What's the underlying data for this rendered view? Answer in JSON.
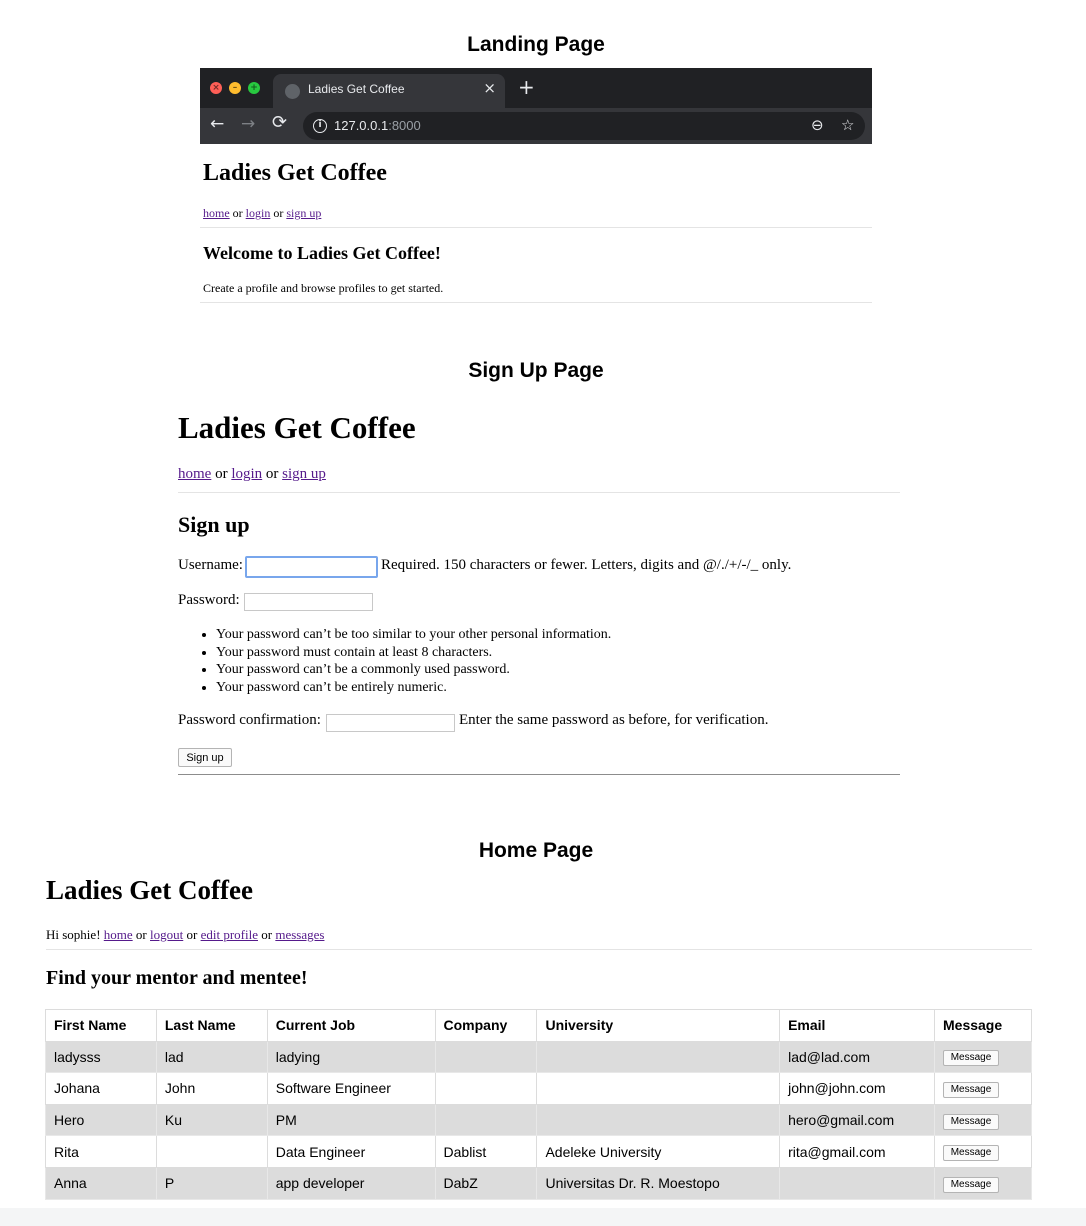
{
  "sections": {
    "landing_title": "Landing Page",
    "signup_title": "Sign Up Page",
    "home_title": "Home Page"
  },
  "browser": {
    "tab_title": "Ladies Get Coffee",
    "tab_close": "×",
    "new_tab": "+",
    "url_host": "127.0.0.1",
    "url_port": ":8000"
  },
  "landing": {
    "site_title": "Ladies Get Coffee",
    "nav": {
      "home": "home",
      "sep1": " or ",
      "login": "login",
      "sep2": " or ",
      "signup": "sign up"
    },
    "heading": "Welcome to Ladies Get Coffee!",
    "text": "Create a profile and browse profiles to get started."
  },
  "signup": {
    "site_title": "Ladies Get Coffee",
    "nav": {
      "home": "home",
      "sep1": " or ",
      "login": "login",
      "sep2": " or ",
      "signup": "sign up"
    },
    "heading": "Sign up",
    "username_label": "Username:",
    "username_help": "Required. 150 characters or fewer. Letters, digits and @/./+/-/_ only.",
    "username_value": "",
    "password_label": "Password:",
    "password_value": "",
    "password_rules": [
      "Your password can’t be too similar to your other personal information.",
      "Your password must contain at least 8 characters.",
      "Your password can’t be a commonly used password.",
      "Your password can’t be entirely numeric."
    ],
    "confirm_label": "Password confirmation:",
    "confirm_value": "",
    "confirm_help": "Enter the same password as before, for verification.",
    "submit_label": "Sign up"
  },
  "home": {
    "site_title": "Ladies Get Coffee",
    "greeting": "Hi sophie! ",
    "nav": {
      "home": "home",
      "sep1": " or ",
      "logout": "logout",
      "sep2": " or ",
      "edit_profile": "edit profile",
      "sep3": " or ",
      "messages": "messages"
    },
    "heading": "Find your mentor and mentee!",
    "columns": [
      "First Name",
      "Last Name",
      "Current Job",
      "Company",
      "University",
      "Email",
      "Message"
    ],
    "rows": [
      [
        "ladysss",
        "lad",
        "ladying",
        "",
        "",
        "lad@lad.com"
      ],
      [
        "Johana",
        "John",
        "Software Engineer",
        "",
        "",
        "john@john.com"
      ],
      [
        "Hero",
        "Ku",
        "PM",
        "",
        "",
        "hero@gmail.com"
      ],
      [
        "Rita",
        "",
        "Data Engineer",
        "Dablist",
        "Adeleke University",
        "rita@gmail.com"
      ],
      [
        "Anna",
        "P",
        "app developer",
        "DabZ",
        "Universitas Dr. R. Moestopo",
        ""
      ]
    ],
    "message_button": "Message"
  }
}
